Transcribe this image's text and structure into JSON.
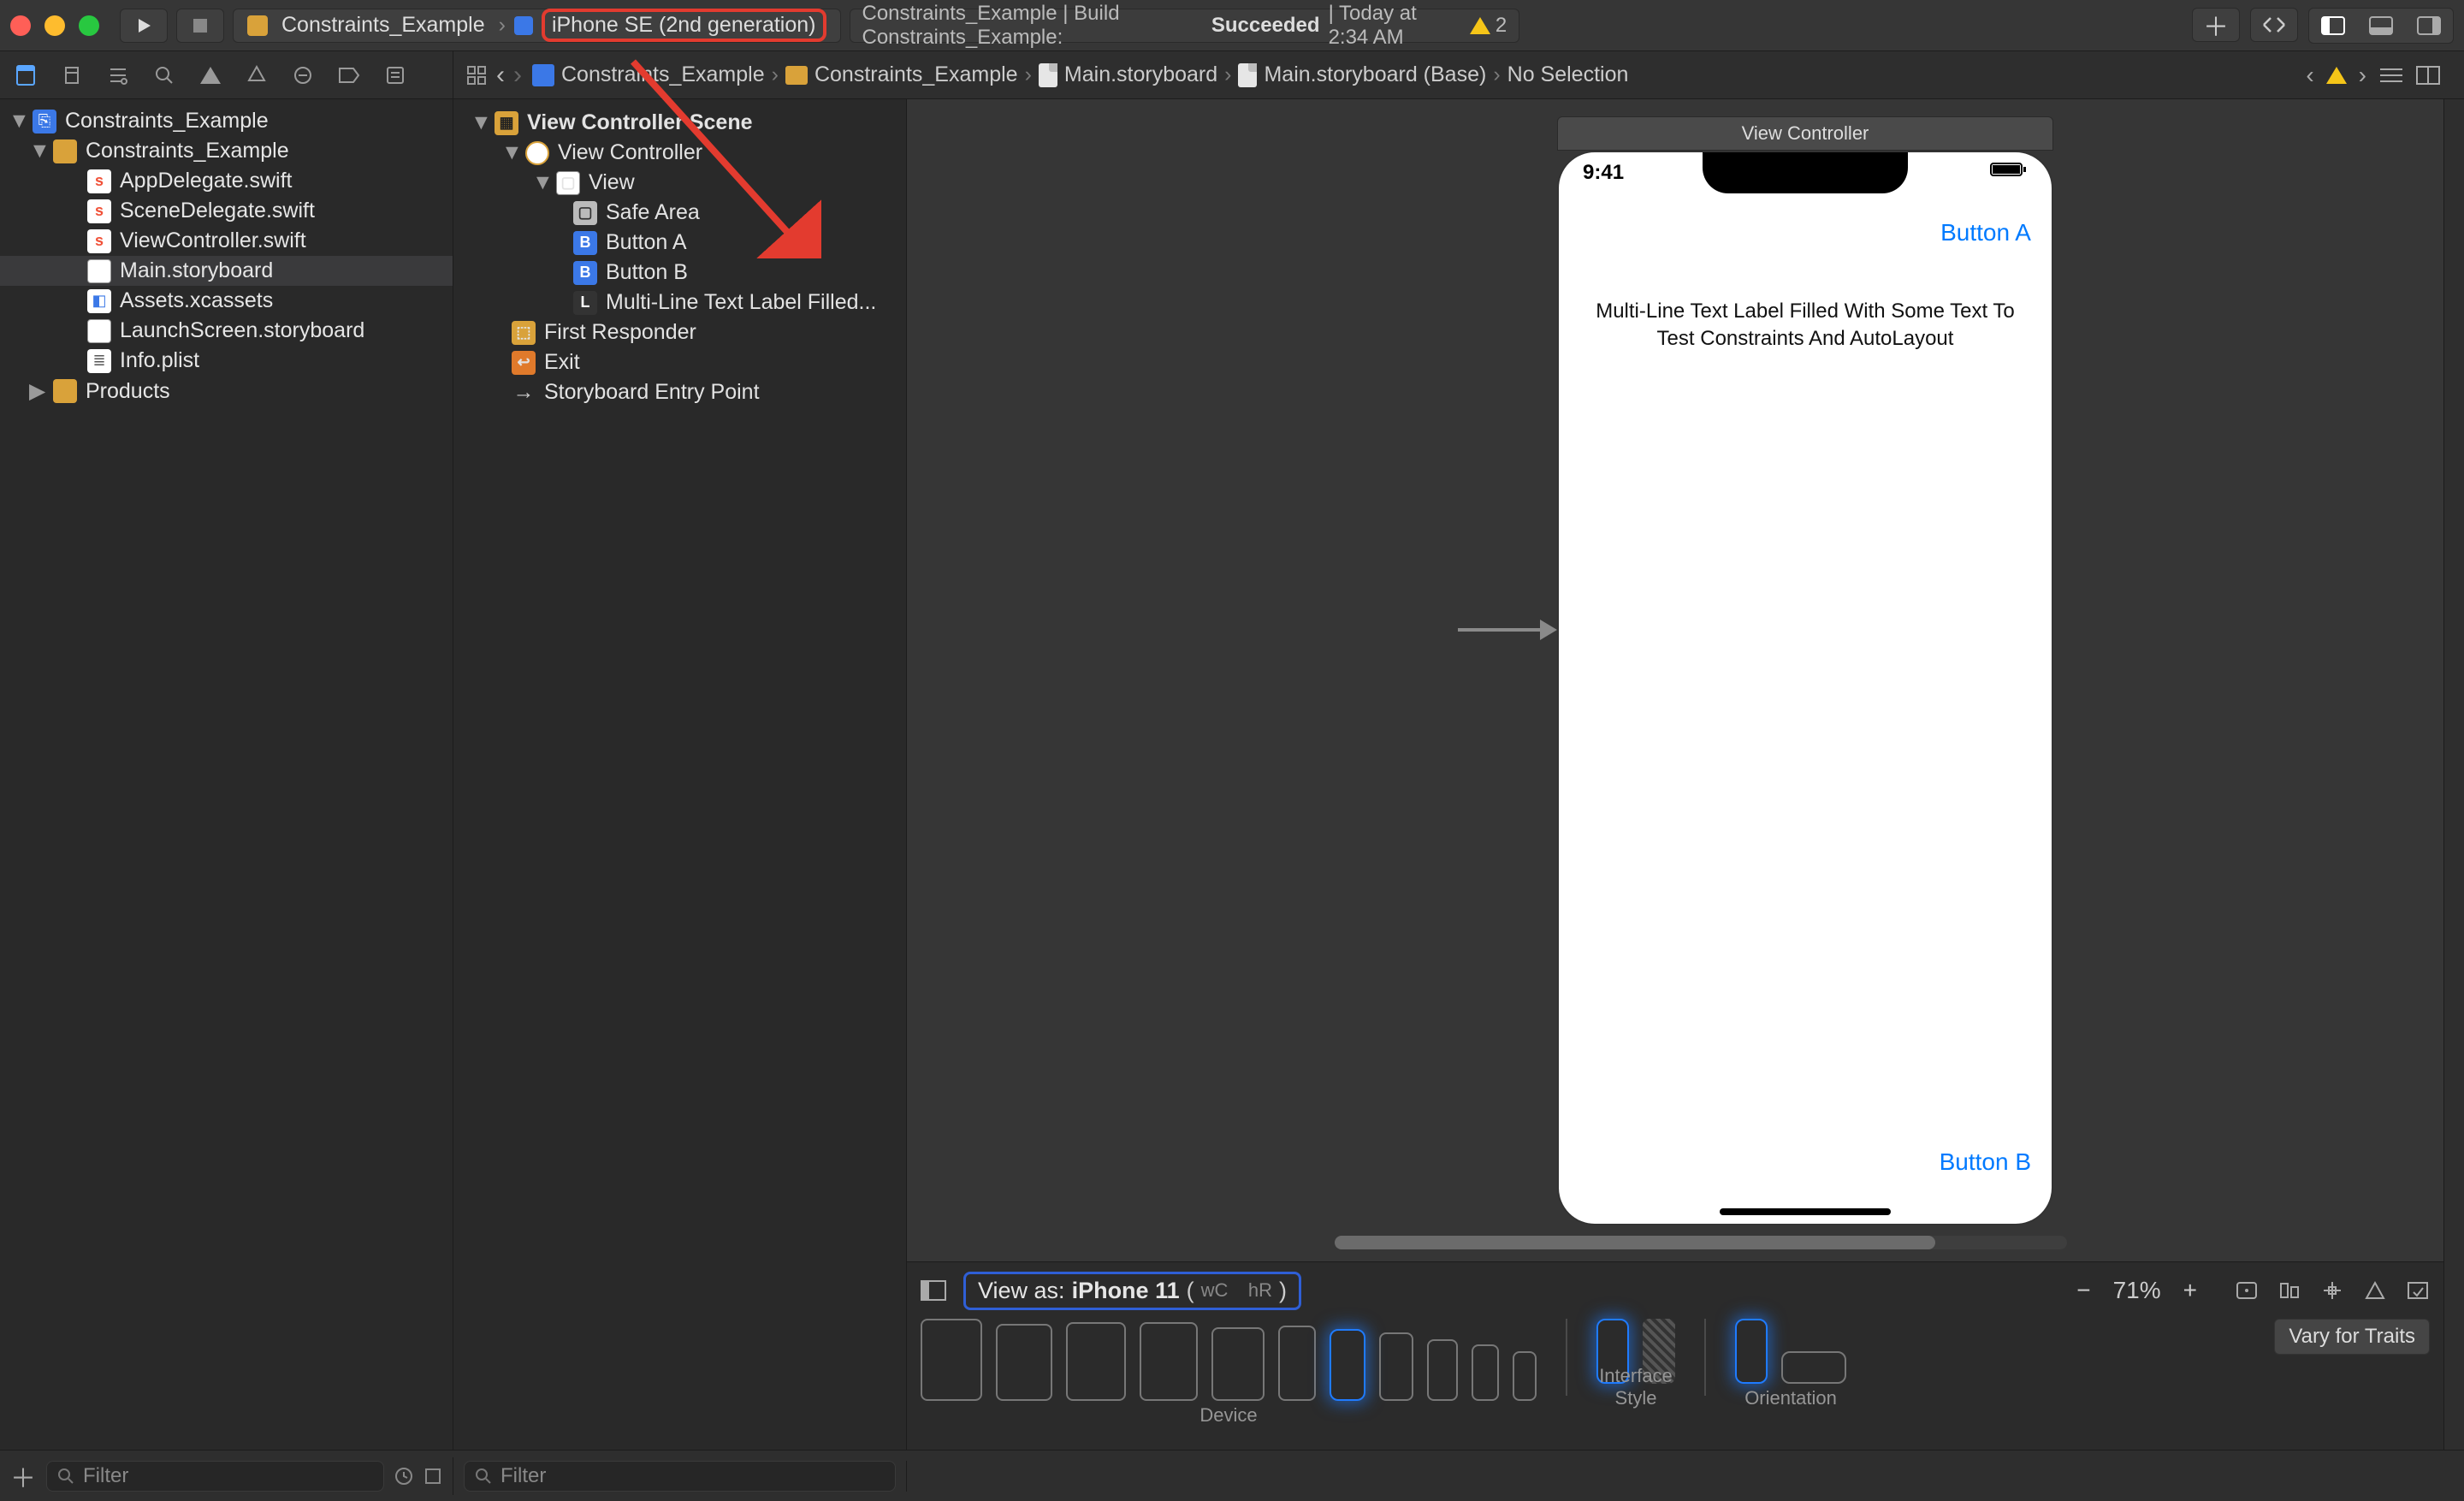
{
  "titlebar": {
    "scheme_project": "Constraints_Example",
    "scheme_target": "iPhone SE (2nd generation)",
    "status_prefix": "Constraints_Example | Build Constraints_Example: ",
    "status_result": "Succeeded",
    "status_time": " | Today at 2:34 AM",
    "warn_count": "2"
  },
  "breadcrumb": {
    "items": [
      "Constraints_Example",
      "Constraints_Example",
      "Main.storyboard",
      "Main.storyboard (Base)",
      "No Selection"
    ]
  },
  "navigator": {
    "root": "Constraints_Example",
    "group": "Constraints_Example",
    "files": [
      "AppDelegate.swift",
      "SceneDelegate.swift",
      "ViewController.swift",
      "Main.storyboard",
      "Assets.xcassets",
      "LaunchScreen.storyboard",
      "Info.plist"
    ],
    "products": "Products"
  },
  "outline": {
    "scene": "View Controller Scene",
    "vc": "View Controller",
    "view": "View",
    "safe": "Safe Area",
    "btnA": "Button A",
    "btnB": "Button B",
    "label": "Multi-Line Text Label Filled...",
    "first_responder": "First Responder",
    "exit": "Exit",
    "entry": "Storyboard Entry Point"
  },
  "canvas": {
    "vc_title": "View Controller",
    "time": "9:41",
    "buttonA": "Button A",
    "buttonB": "Button B",
    "label_text": "Multi-Line Text Label Filled With Some Text To Test Constraints And AutoLayout"
  },
  "footer": {
    "view_as_prefix": "View as: ",
    "view_as_device": "iPhone 11",
    "view_as_trait_w": "wC",
    "view_as_trait_h": "hR",
    "zoom": "71%",
    "group_device": "Device",
    "group_style": "Interface Style",
    "group_orient": "Orientation",
    "vary": "Vary for Traits"
  },
  "filters": {
    "placeholder": "Filter"
  }
}
